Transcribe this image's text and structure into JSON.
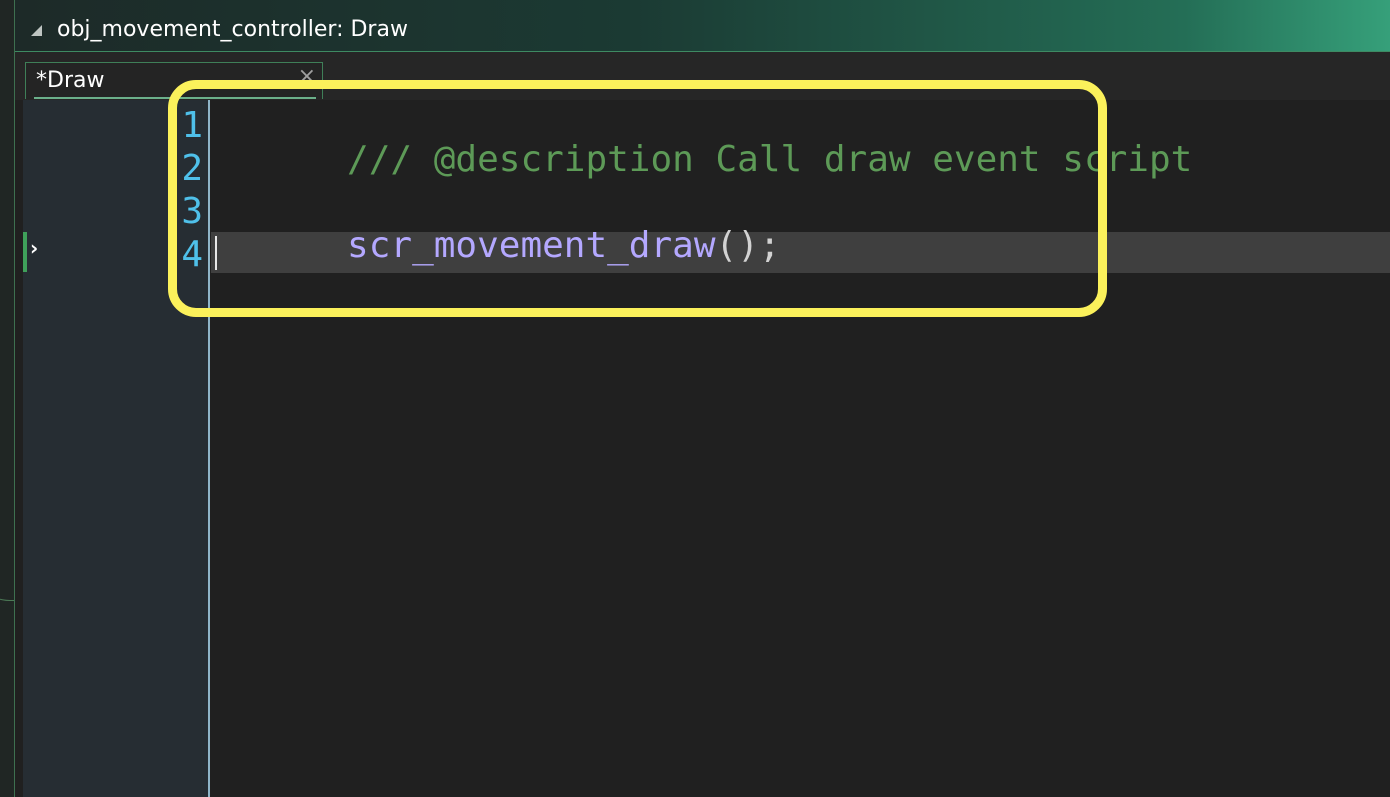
{
  "window": {
    "title": "obj_movement_controller: Draw"
  },
  "tabs": [
    {
      "label": "*Draw",
      "close_glyph": "×"
    }
  ],
  "editor": {
    "line_numbers": [
      "1",
      "2",
      "3",
      "4"
    ],
    "lines": [
      {
        "comment": "/// @description Call draw event script"
      },
      {
        "text": ""
      },
      {
        "func": "scr_movement_draw",
        "punc": "();"
      },
      {
        "text": ""
      }
    ],
    "current_line": 4,
    "gutter_marker_glyph": "›"
  },
  "colors": {
    "comment": "#5d9a57",
    "function": "#b4a8ff",
    "line_number": "#4fc0ea",
    "highlight_box": "#fbf15b",
    "accent": "#3fa05a"
  }
}
